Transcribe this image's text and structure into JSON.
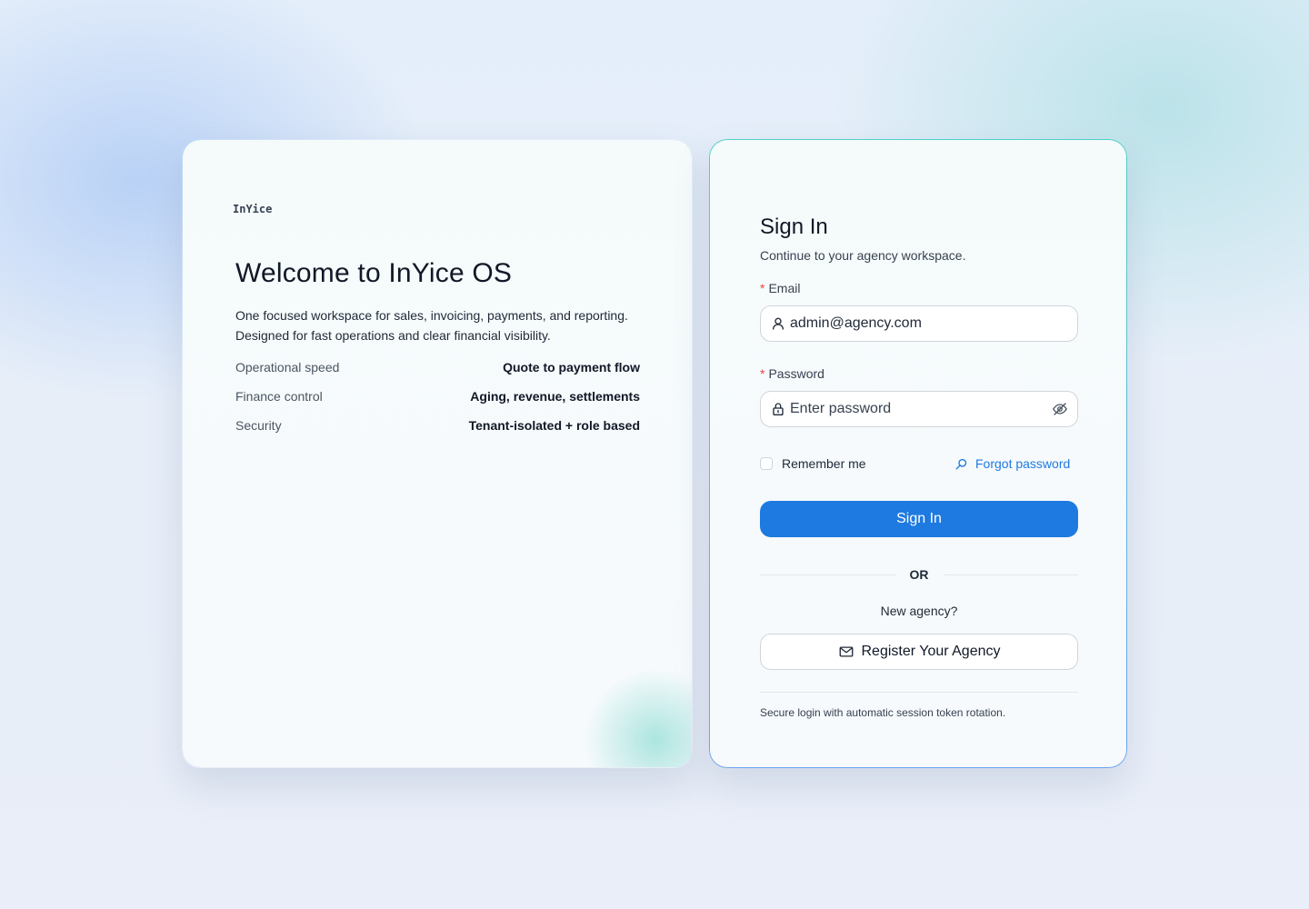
{
  "brand": {
    "name": "InYice"
  },
  "welcome": {
    "title": "Welcome to InYice OS",
    "description_lines": [
      "One focused workspace for sales, invoicing, payments, and reporting.",
      "Designed for fast operations and clear financial visibility."
    ],
    "features": [
      {
        "label": "Operational speed",
        "value": "Quote to payment flow"
      },
      {
        "label": "Finance control",
        "value": "Aging, revenue, settlements"
      },
      {
        "label": "Security",
        "value": "Tenant-isolated + role based"
      }
    ]
  },
  "signin": {
    "title": "Sign In",
    "subtitle": "Continue to your agency workspace.",
    "required_mark": "*",
    "email": {
      "label": "Email",
      "value": "admin@agency.com",
      "icon": "user-icon"
    },
    "password": {
      "label": "Password",
      "placeholder": "Enter password",
      "value": "",
      "icon": "lock-icon",
      "toggle_icon": "eye-off-icon"
    },
    "remember_label": "Remember me",
    "remember_checked": false,
    "forgot_label": "Forgot password",
    "forgot_icon": "search-key-icon",
    "submit_label": "Sign In",
    "divider_label": "OR",
    "new_agency_label": "New agency?",
    "register_label": "Register Your Agency",
    "register_icon": "mail-icon",
    "footer_note": "Secure login with automatic session token rotation."
  },
  "colors": {
    "primary": "#1e7ae0",
    "required": "#ef4444",
    "border_gradient_top": "#4fd1c5",
    "border_gradient_bottom": "#6aa3f0"
  }
}
